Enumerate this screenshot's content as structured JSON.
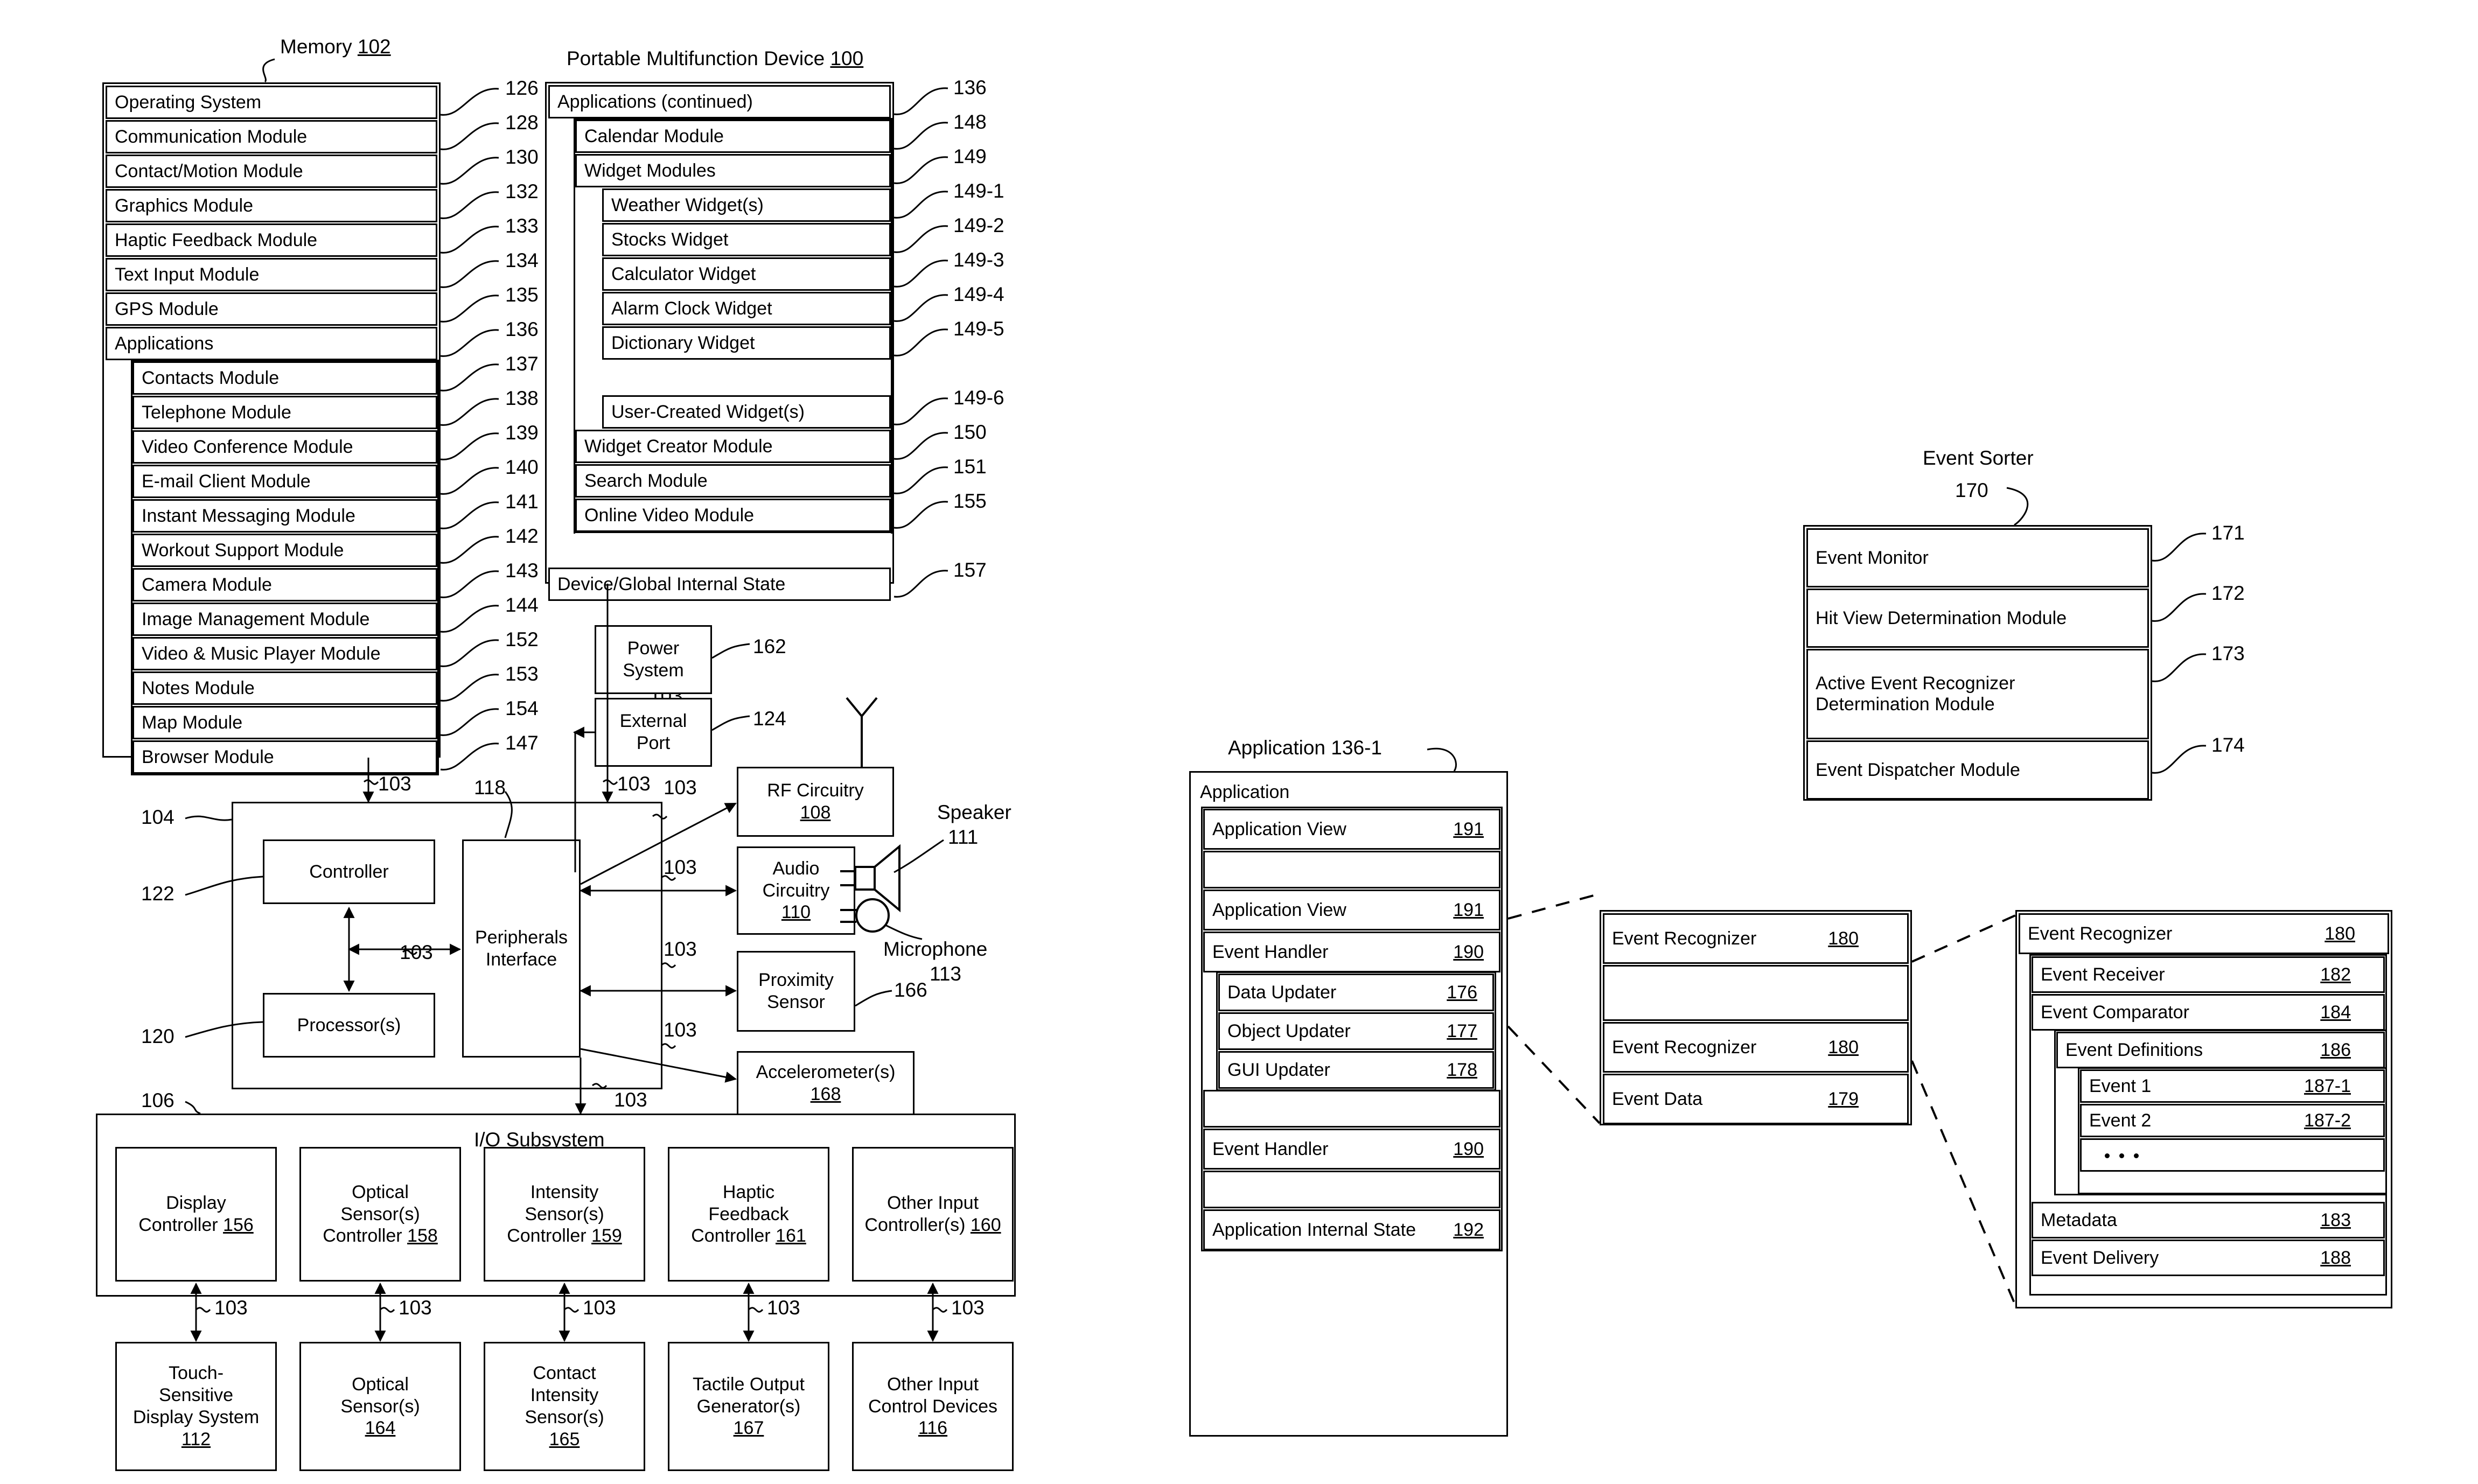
{
  "figure": {
    "memory_title": "Memory 102",
    "memory_title_num": "102",
    "device_title": "Portable Multifunction Device 100",
    "event_sorter_title": "Event Sorter",
    "event_sorter_num": "170",
    "application_title": "Application 136-1",
    "io_subsystem_title": "I/O Subsystem"
  },
  "memory": {
    "items": [
      {
        "label": "Operating System",
        "ref": "126",
        "indent": 0
      },
      {
        "label": "Communication Module",
        "ref": "128",
        "indent": 0
      },
      {
        "label": "Contact/Motion Module",
        "ref": "130",
        "indent": 0
      },
      {
        "label": "Graphics Module",
        "ref": "132",
        "indent": 0
      },
      {
        "label": "Haptic Feedback Module",
        "ref": "133",
        "indent": 0
      },
      {
        "label": "Text Input Module",
        "ref": "134",
        "indent": 0
      },
      {
        "label": "GPS Module",
        "ref": "135",
        "indent": 0
      },
      {
        "label": "Applications",
        "ref": "136",
        "indent": 0
      },
      {
        "label": "Contacts Module",
        "ref": "137",
        "indent": 1
      },
      {
        "label": "Telephone Module",
        "ref": "138",
        "indent": 1
      },
      {
        "label": "Video Conference Module",
        "ref": "139",
        "indent": 1
      },
      {
        "label": "E-mail Client Module",
        "ref": "140",
        "indent": 1
      },
      {
        "label": "Instant Messaging Module",
        "ref": "141",
        "indent": 1
      },
      {
        "label": "Workout Support Module",
        "ref": "142",
        "indent": 1
      },
      {
        "label": "Camera Module",
        "ref": "143",
        "indent": 1
      },
      {
        "label": "Image Management Module",
        "ref": "144",
        "indent": 1
      },
      {
        "label": "Video & Music Player Module",
        "ref": "152",
        "indent": 1
      },
      {
        "label": "Notes Module",
        "ref": "153",
        "indent": 1
      },
      {
        "label": "Map Module",
        "ref": "154",
        "indent": 1
      },
      {
        "label": "Browser Module",
        "ref": "147",
        "indent": 1
      }
    ]
  },
  "device": {
    "applications_continued": "Applications (continued)",
    "applications_continued_ref": "136",
    "items": [
      {
        "label": "Calendar Module",
        "ref": "148",
        "indent": 1
      },
      {
        "label": "Widget Modules",
        "ref": "149",
        "indent": 1
      },
      {
        "label": "Weather Widget(s)",
        "ref": "149-1",
        "indent": 2
      },
      {
        "label": "Stocks Widget",
        "ref": "149-2",
        "indent": 2
      },
      {
        "label": "Calculator Widget",
        "ref": "149-3",
        "indent": 2
      },
      {
        "label": "Alarm Clock Widget",
        "ref": "149-4",
        "indent": 2
      },
      {
        "label": "Dictionary Widget",
        "ref": "149-5",
        "indent": 2
      },
      {
        "label": "",
        "ref": "",
        "indent": 2,
        "dots": true
      },
      {
        "label": "User-Created Widget(s)",
        "ref": "149-6",
        "indent": 2
      },
      {
        "label": "Widget Creator Module",
        "ref": "150",
        "indent": 1
      },
      {
        "label": "Search Module",
        "ref": "151",
        "indent": 1
      },
      {
        "label": "Online Video Module",
        "ref": "155",
        "indent": 1
      },
      {
        "label": "",
        "ref": "",
        "indent": 1,
        "dots": true
      },
      {
        "label": "Device/Global Internal State",
        "ref": "157",
        "indent": 0
      }
    ]
  },
  "core": {
    "controller": "Controller",
    "controller_ref": "122",
    "processors": "Processor(s)",
    "processors_ref": "120",
    "peripherals_interface": "Peripherals\nInterface",
    "peripherals_ref": "118",
    "cpu_block_ref": "104",
    "bus_ref": "103",
    "io_ref": "106"
  },
  "peripherals": {
    "power_system": "Power\nSystem",
    "power_system_ref": "162",
    "external_port": "External\nPort",
    "external_port_ref": "124",
    "rf_circuitry": "RF Circuitry",
    "rf_circuitry_ref": "108",
    "audio_circuitry": "Audio\nCircuitry",
    "audio_circuitry_ref": "110",
    "speaker": "Speaker",
    "speaker_ref": "111",
    "microphone": "Microphone",
    "microphone_ref": "113",
    "proximity_sensor": "Proximity\nSensor",
    "proximity_sensor_ref": "166",
    "accelerometers": "Accelerometer(s)",
    "accelerometers_ref": "168"
  },
  "io_subsystem": {
    "title": "I/O Subsystem",
    "ref": "106",
    "controllers": [
      {
        "line1": "Display",
        "line2": "Controller",
        "ref": "156"
      },
      {
        "line1": "Optical",
        "line2": "Sensor(s)",
        "line3": "Controller",
        "ref": "158"
      },
      {
        "line1": "Intensity",
        "line2": "Sensor(s)",
        "line3": "Controller",
        "ref": "159"
      },
      {
        "line1": "Haptic",
        "line2": "Feedback",
        "line3": "Controller",
        "ref": "161"
      },
      {
        "line1": "Other Input",
        "line2": "Controller(s)",
        "ref": "160"
      }
    ],
    "devices": [
      {
        "line1": "Touch-",
        "line2": "Sensitive",
        "line3": "Display System",
        "ref": "112"
      },
      {
        "line1": "Optical",
        "line2": "Sensor(s)",
        "ref": "164"
      },
      {
        "line1": "Contact",
        "line2": "Intensity",
        "line3": "Sensor(s)",
        "ref": "165"
      },
      {
        "line1": "Tactile Output",
        "line2": "Generator(s)",
        "ref": "167"
      },
      {
        "line1": "Other Input",
        "line2": "Control Devices",
        "ref": "116"
      }
    ],
    "link_ref": "103"
  },
  "event_sorter": {
    "title": "Event Sorter",
    "ref": "170",
    "items": [
      {
        "label": "Event Monitor",
        "ref": "171"
      },
      {
        "label": "Hit View Determination Module",
        "ref": "172"
      },
      {
        "label": "Active Event Recognizer\nDetermination Module",
        "ref": "173"
      },
      {
        "label": "Event Dispatcher Module",
        "ref": "174"
      }
    ]
  },
  "application": {
    "title": "Application 136-1",
    "header": "Application",
    "items": [
      {
        "label": "Application View",
        "num": "191",
        "dots": false
      },
      {
        "label": "",
        "num": "",
        "dots": true
      },
      {
        "label": "Application View",
        "num": "191",
        "dots": false
      },
      {
        "label": "Event Handler",
        "num": "190",
        "dots": false
      },
      {
        "label": "Data Updater",
        "num": "176",
        "nested": true
      },
      {
        "label": "Object Updater",
        "num": "177",
        "nested": true
      },
      {
        "label": "GUI Updater",
        "num": "178",
        "nested": true
      },
      {
        "label": "",
        "num": "",
        "dots": true
      },
      {
        "label": "Event Handler",
        "num": "190",
        "dots": false
      },
      {
        "label": "",
        "num": "",
        "dots": true
      },
      {
        "label": "Application Internal State",
        "num": "192",
        "dots": false
      }
    ]
  },
  "event_recognizer_list": {
    "items": [
      {
        "label": "Event Recognizer",
        "num": "180",
        "dots": false
      },
      {
        "label": "",
        "num": "",
        "dots": true
      },
      {
        "label": "Event Recognizer",
        "num": "180",
        "dots": false
      },
      {
        "label": "Event Data",
        "num": "179",
        "dots": false
      }
    ]
  },
  "event_recognizer_detail": {
    "header": "Event Recognizer",
    "header_num": "180",
    "event_receiver": "Event Receiver",
    "event_receiver_num": "182",
    "event_comparator": "Event Comparator",
    "event_comparator_num": "184",
    "event_definitions": "Event Definitions",
    "event_definitions_num": "186",
    "event1": "Event 1",
    "event1_num": "187-1",
    "event2": "Event 2",
    "event2_num": "187-2",
    "metadata": "Metadata",
    "metadata_num": "183",
    "event_delivery": "Event Delivery",
    "event_delivery_num": "188"
  }
}
